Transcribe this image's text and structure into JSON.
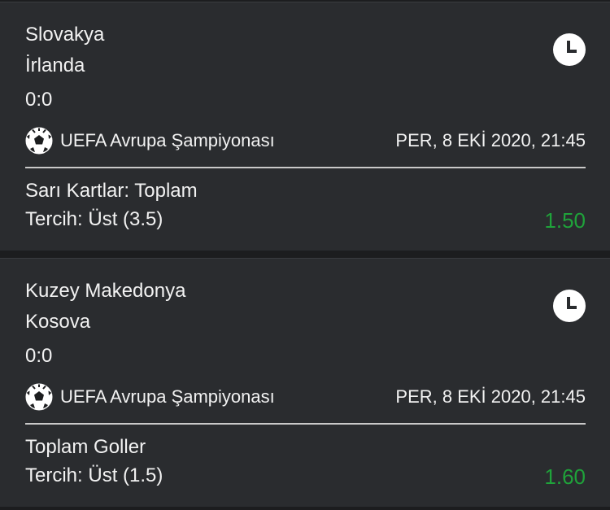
{
  "colors": {
    "background": "#1c1d1f",
    "card": "#2a2c2f",
    "text": "#f2f2f2",
    "odds": "#1fa33a",
    "divider": "#c9c9c9"
  },
  "bets": [
    {
      "home_team": "Slovakya",
      "away_team": "İrlanda",
      "score": "0:0",
      "status_icon": "clock-icon",
      "sport_icon": "soccer-ball-icon",
      "league": "UEFA Avrupa Şampiyonası",
      "datetime": "PER, 8 EKİ 2020, 21:45",
      "market": "Sarı Kartlar: Toplam",
      "selection": "Tercih: Üst (3.5)",
      "odds": "1.50"
    },
    {
      "home_team": "Kuzey Makedonya",
      "away_team": "Kosova",
      "score": "0:0",
      "status_icon": "clock-icon",
      "sport_icon": "soccer-ball-icon",
      "league": "UEFA Avrupa Şampiyonası",
      "datetime": "PER, 8 EKİ 2020, 21:45",
      "market": "Toplam Goller",
      "selection": "Tercih: Üst (1.5)",
      "odds": "1.60"
    }
  ]
}
